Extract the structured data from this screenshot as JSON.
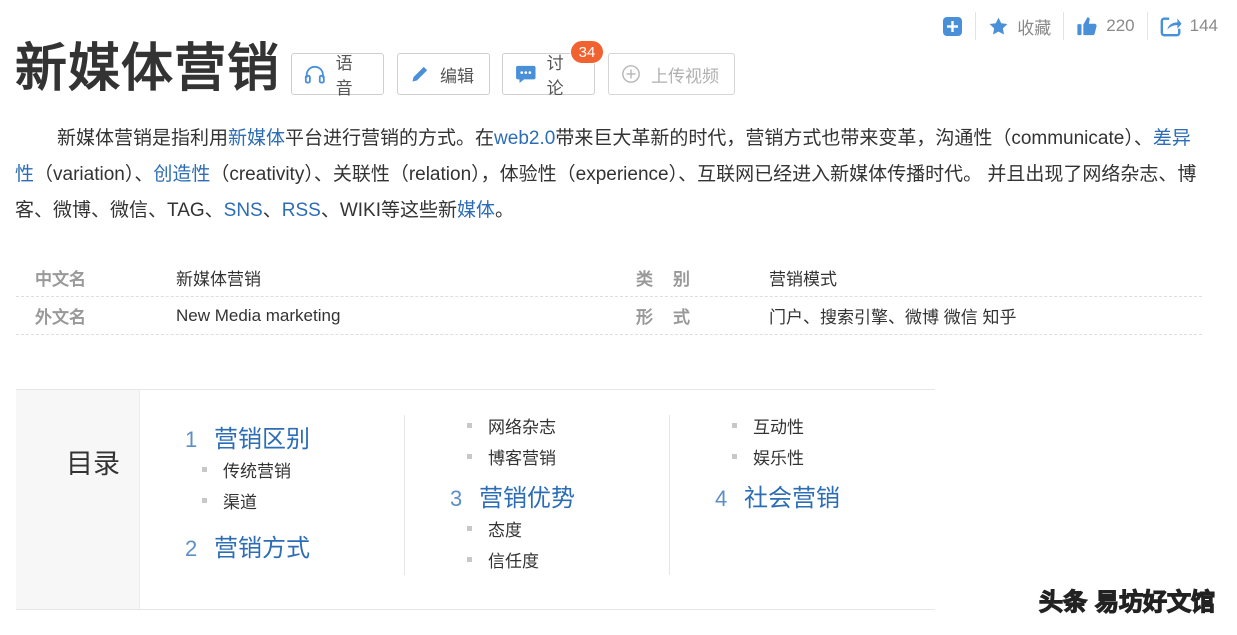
{
  "actions": {
    "collect_label": "收藏",
    "like_count": "220",
    "share_count": "144"
  },
  "title": "新媒体营销",
  "buttons": {
    "voice": "语音",
    "edit": "编辑",
    "discuss": "讨论",
    "discuss_badge": "34",
    "upload_video": "上传视频"
  },
  "summary": {
    "p1": "新媒体营销是指利用",
    "l1": "新媒体",
    "p2": "平台进行营销的方式。在",
    "l2": "web2.0",
    "p3": "带来巨大革新的时代，营销方式也带来变革，沟通性（communicate）、",
    "l3": "差异性",
    "p4": "（variation）、",
    "l4": "创造性",
    "p5": "（creativity）、关联性（relation），体验性（experience）、互联网已经进入新媒体传播时代。 并且出现了网络杂志、博客、微博、微信、TAG、",
    "l5": "SNS",
    "p6": "、",
    "l6": "RSS",
    "p7": "、WIKI等这些新",
    "l7": "媒体",
    "p8": "。"
  },
  "info": [
    {
      "k": "中文名",
      "v": "新媒体营销",
      "k2": "类别",
      "v2": "营销模式"
    },
    {
      "k": "外文名",
      "v": "New Media marketing",
      "k2": "形式",
      "v2": "门户、搜索引擎、微博 微信 知乎"
    }
  ],
  "catalog": {
    "heading": "目录",
    "col1": {
      "s1_num": "1",
      "s1": "营销区别",
      "s1_items": [
        "传统营销",
        "渠道"
      ],
      "s2_num": "2",
      "s2": "营销方式"
    },
    "col2": {
      "items_top": [
        "网络杂志",
        "博客营销"
      ],
      "s3_num": "3",
      "s3": "营销优势",
      "s3_items": [
        "态度",
        "信任度"
      ]
    },
    "col3": {
      "items_top": [
        "互动性",
        "娱乐性"
      ],
      "s4_num": "4",
      "s4": "社会营销"
    }
  },
  "watermark": {
    "a": "头条",
    "b": "易坊好文馆"
  },
  "colors": {
    "link": "#2d6db5",
    "action_icon": "#4a90d9",
    "badge": "#f06230"
  }
}
